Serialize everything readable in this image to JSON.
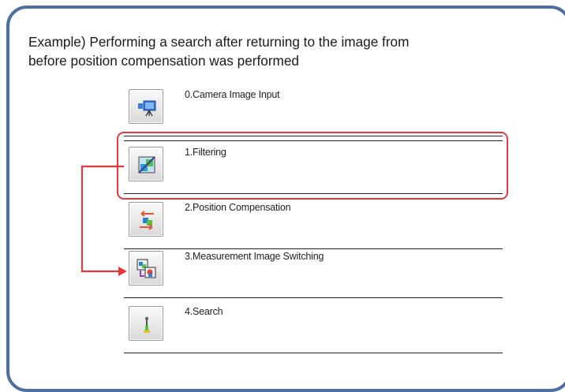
{
  "caption": {
    "line1": "Example) Performing a search after returning to the image from",
    "line2": "before position compensation was performed"
  },
  "flow_items": [
    {
      "label": "0.Camera Image Input",
      "icon": "camera-icon"
    },
    {
      "label": "1.Filtering",
      "icon": "filter-icon"
    },
    {
      "label": "2.Position Compensation",
      "icon": "position-compensation-icon"
    },
    {
      "label": "3.Measurement Image Switching",
      "icon": "image-switching-icon"
    },
    {
      "label": "4.Search",
      "icon": "search-icon"
    }
  ],
  "colors": {
    "frame_border": "#4d70a4",
    "highlight": "#e03a3e",
    "arrow": "#e03a3e"
  }
}
